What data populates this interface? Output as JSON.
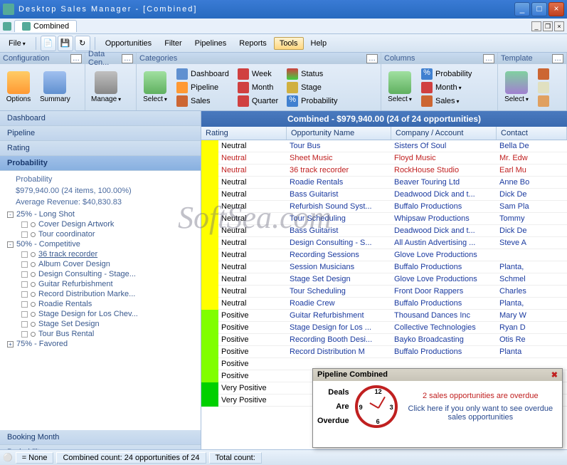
{
  "window": {
    "title": "Desktop Sales Manager - [Combined]"
  },
  "tab": {
    "label": "Combined"
  },
  "menu": {
    "file": "File",
    "opportunities": "Opportunities",
    "filter": "Filter",
    "pipelines": "Pipelines",
    "reports": "Reports",
    "tools": "Tools",
    "help": "Help"
  },
  "ribbon": {
    "configuration": {
      "title": "Configuration",
      "options": "Options",
      "summary": "Summary"
    },
    "datacen": {
      "title": "Data Cen...",
      "manage": "Manage"
    },
    "categories": {
      "title": "Categories",
      "select": "Select",
      "dashboard": "Dashboard",
      "pipeline": "Pipeline",
      "sales": "Sales",
      "week": "Week",
      "month": "Month",
      "quarter": "Quarter",
      "status": "Status",
      "stage": "Stage",
      "probability": "Probability"
    },
    "columns": {
      "title": "Columns",
      "select": "Select",
      "probability": "Probability",
      "month": "Month",
      "sales": "Sales"
    },
    "template": {
      "title": "Template",
      "select": "Select"
    }
  },
  "sidebar": {
    "dashboard": "Dashboard",
    "pipeline": "Pipeline",
    "rating": "Rating",
    "probability": "Probability",
    "booking_month": "Booking Month",
    "probability2": "Probability",
    "info1": "Probability",
    "info2": "$979,940.00 (24 items, 100.00%)",
    "info3": "Average Revenue: $40,830.83",
    "groups": [
      {
        "label": "25% - Long Shot",
        "items": [
          "Cover Design Artwork",
          "Tour coordinator"
        ]
      },
      {
        "label": "50% - Competitive",
        "items": [
          "36 track recorder",
          "Album Cover Design",
          "Design Consulting - Stage...",
          "Guitar Refurbishment",
          "Record Distribution Marke...",
          "Roadie Rentals",
          "Stage Design for Los Chev...",
          "Stage Set Design",
          "Tour Bus Rental"
        ]
      },
      {
        "label": "75% - Favored",
        "items": []
      }
    ]
  },
  "grid": {
    "title": "Combined - $979,940.00 (24 of 24 opportunities)",
    "columns": {
      "rating": "Rating",
      "opp": "Opportunity Name",
      "company": "Company / Account",
      "contact": "Contact"
    },
    "rows": [
      {
        "swatch": "#ffff00",
        "rating": "Neutral",
        "opp": "Tour Bus",
        "company": "Sisters Of Soul",
        "contact": "Bella De",
        "red": false
      },
      {
        "swatch": "#ffff00",
        "rating": "Neutral",
        "opp": "Sheet Music",
        "company": "Floyd Music",
        "contact": "Mr. Edw",
        "red": true
      },
      {
        "swatch": "#ffff00",
        "rating": "Neutral",
        "opp": "36 track recorder",
        "company": "RockHouse Studio",
        "contact": "Earl Mu",
        "red": true
      },
      {
        "swatch": "#ffff00",
        "rating": "Neutral",
        "opp": "Roadie Rentals",
        "company": "Beaver Touring Ltd",
        "contact": "Anne Bo",
        "red": false
      },
      {
        "swatch": "#ffff00",
        "rating": "Neutral",
        "opp": "Bass Guitarist",
        "company": "Deadwood Dick and t...",
        "contact": "Dick De",
        "red": false
      },
      {
        "swatch": "#ffff00",
        "rating": "Neutral",
        "opp": "Refurbish Sound Syst...",
        "company": "Buffalo Productions",
        "contact": "Sam Pla",
        "red": false
      },
      {
        "swatch": "#ffff00",
        "rating": "Neutral",
        "opp": "Tour Scheduling",
        "company": "Whipsaw Productions",
        "contact": "Tommy",
        "red": false
      },
      {
        "swatch": "#ffff00",
        "rating": "Neutral",
        "opp": "Bass Guitarist",
        "company": "Deadwood Dick and t...",
        "contact": "Dick De",
        "red": false
      },
      {
        "swatch": "#ffff00",
        "rating": "Neutral",
        "opp": "Design Consulting - S...",
        "company": "All Austin Advertising ...",
        "contact": "Steve A",
        "red": false
      },
      {
        "swatch": "#ffff00",
        "rating": "Neutral",
        "opp": "Recording Sessions",
        "company": "Glove Love Productions",
        "contact": "",
        "red": false
      },
      {
        "swatch": "#ffff00",
        "rating": "Neutral",
        "opp": "Session Musicians",
        "company": "Buffalo Productions",
        "contact": "Planta,",
        "red": false
      },
      {
        "swatch": "#ffff00",
        "rating": "Neutral",
        "opp": "Stage Set Design",
        "company": "Glove Love Productions",
        "contact": "Schmel",
        "red": false
      },
      {
        "swatch": "#ffff00",
        "rating": "Neutral",
        "opp": "Tour Scheduling",
        "company": "Front Door Rappers",
        "contact": "Charles",
        "red": false
      },
      {
        "swatch": "#ffff00",
        "rating": "Neutral",
        "opp": "Roadie Crew",
        "company": "Buffalo Productions",
        "contact": "Planta,",
        "red": false
      },
      {
        "swatch": "#80ff00",
        "rating": "Positive",
        "opp": "Guitar Refurbishment",
        "company": "Thousand Dances Inc",
        "contact": "Mary W",
        "red": false
      },
      {
        "swatch": "#80ff00",
        "rating": "Positive",
        "opp": "Stage Design for Los ...",
        "company": "Collective Technologies",
        "contact": "Ryan D",
        "red": false
      },
      {
        "swatch": "#80ff00",
        "rating": "Positive",
        "opp": "Recording Booth Desi...",
        "company": "Bayko Broadcasting",
        "contact": "Otis Re",
        "red": false
      },
      {
        "swatch": "#80ff00",
        "rating": "Positive",
        "opp": "Record Distribution M",
        "company": "Buffalo Productions",
        "contact": "Planta",
        "red": false
      },
      {
        "swatch": "#80ff00",
        "rating": "Positive",
        "opp": "",
        "company": "",
        "contact": "",
        "red": false
      },
      {
        "swatch": "#80ff00",
        "rating": "Positive",
        "opp": "",
        "company": "",
        "contact": "",
        "red": false
      },
      {
        "swatch": "#00d000",
        "rating": "Very Positive",
        "opp": "",
        "company": "",
        "contact": "",
        "red": false
      },
      {
        "swatch": "#00d000",
        "rating": "Very Positive",
        "opp": "",
        "company": "",
        "contact": "",
        "red": false
      }
    ]
  },
  "status": {
    "none": "= None",
    "combined": "Combined count: 24 opportunities of 24",
    "total": "Total count:"
  },
  "popup": {
    "title": "Pipeline Combined",
    "deals1": "Deals",
    "deals2": "Are",
    "deals3": "Overdue",
    "text1": "2 sales opportunities are overdue",
    "text2": "Click here if you only want to see overdue sales opportunities"
  },
  "watermark": "SoftSea.com"
}
